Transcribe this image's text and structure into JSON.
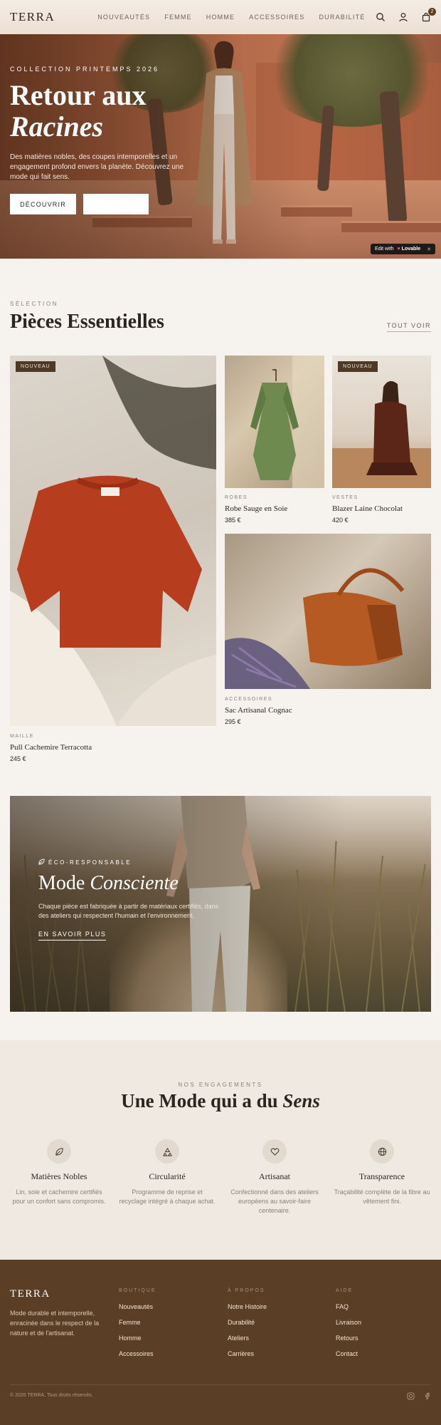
{
  "header": {
    "logo": "TERRA",
    "nav": [
      "NOUVEAUTÉS",
      "FEMME",
      "HOMME",
      "ACCESSOIRES",
      "DURABILITÉ"
    ],
    "cart_count": "2",
    "icons": [
      "search-icon",
      "user-icon",
      "shopping-bag-icon"
    ]
  },
  "hero": {
    "eyebrow": "COLLECTION PRINTEMPS 2026",
    "title_line1": "Retour aux",
    "title_line2": "Racines",
    "description": "Des matières nobles, des coupes intemporelles et un engagement profond envers la planète. Découvrez une mode qui fait sens.",
    "primary_button": "DÉCOUVRIR",
    "secondary_button": "",
    "badge_prefix": "Edit with",
    "badge_brand": "Lovable"
  },
  "selection": {
    "eyebrow": "SÉLECTION",
    "title": "Pièces Essentielles",
    "see_all": "TOUT VOIR",
    "products": [
      {
        "tag": "NOUVEAU",
        "category": "MAILLE",
        "name": "Pull Cachemire Terracotta",
        "price": "245 €"
      },
      {
        "tag": "",
        "category": "ROBES",
        "name": "Robe Sauge en Soie",
        "price": "385 €"
      },
      {
        "tag": "NOUVEAU",
        "category": "VESTES",
        "name": "Blazer Laine Chocolat",
        "price": "420 €"
      },
      {
        "tag": "",
        "category": "ACCESSOIRES",
        "name": "Sac Artisanal Cognac",
        "price": "295 €"
      }
    ]
  },
  "conscious": {
    "eyebrow": "ÉCO-RESPONSABLE",
    "title_plain": "Mode",
    "title_italic": "Consciente",
    "description": "Chaque pièce est fabriquée à partir de matériaux certifiés, dans des ateliers qui respectent l'humain et l'environnement.",
    "link": "EN SAVOIR PLUS"
  },
  "commitments": {
    "eyebrow": "NOS ENGAGEMENTS",
    "title_plain": "Une Mode qui a du",
    "title_italic": "Sens",
    "items": [
      {
        "icon": "leaf-icon",
        "title": "Matières Nobles",
        "description": "Lin, soie et cachemire certifiés pour un confort sans compromis."
      },
      {
        "icon": "recycle-icon",
        "title": "Circularité",
        "description": "Programme de reprise et recyclage intégré à chaque achat."
      },
      {
        "icon": "heart-icon",
        "title": "Artisanat",
        "description": "Confectionné dans des ateliers européens au savoir-faire centenaire."
      },
      {
        "icon": "globe-icon",
        "title": "Transparence",
        "description": "Traçabilité complète de la fibre au vêtement fini."
      }
    ]
  },
  "footer": {
    "logo": "TERRA",
    "tagline": "Mode durable et intemporelle, enracinée dans le respect de la nature et de l'artisanat.",
    "columns": [
      {
        "title": "BOUTIQUE",
        "links": [
          "Nouveautés",
          "Femme",
          "Homme",
          "Accessoires"
        ]
      },
      {
        "title": "À PROPOS",
        "links": [
          "Notre Histoire",
          "Durabilité",
          "Ateliers",
          "Carrières"
        ]
      },
      {
        "title": "AIDE",
        "links": [
          "FAQ",
          "Livraison",
          "Retours",
          "Contact"
        ]
      }
    ],
    "copyright": "© 2026 TERRA. Tous droits réservés.",
    "social": [
      "instagram-icon",
      "facebook-icon"
    ]
  },
  "colors": {
    "background": "#f6f3ee",
    "footer": "#5a3e25",
    "tag": "#4e3826",
    "text": "#2b2520",
    "muted": "#8c8178"
  }
}
